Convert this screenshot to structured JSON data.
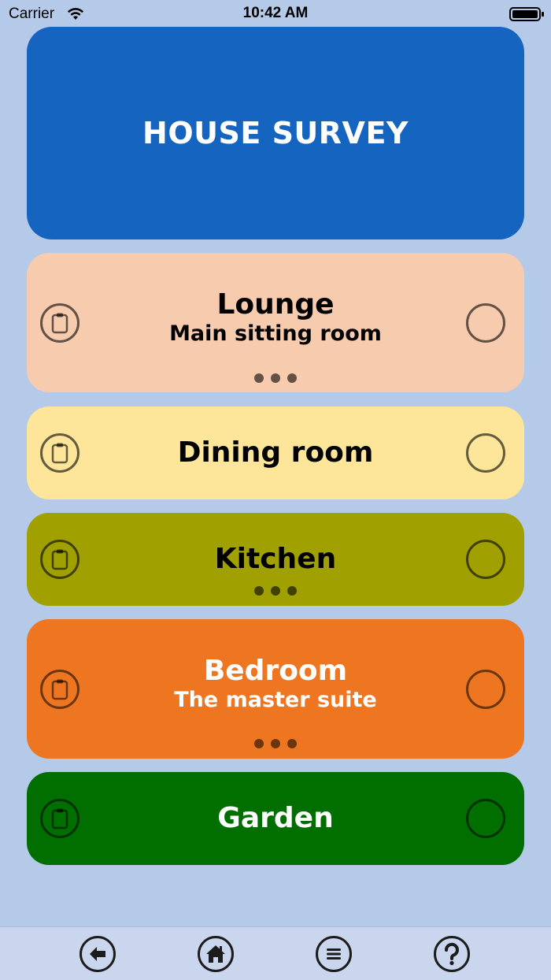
{
  "status_bar": {
    "carrier": "Carrier",
    "time": "10:42 AM"
  },
  "header": {
    "title": "HOUSE SURVEY",
    "color": "#1565c0"
  },
  "rooms": [
    {
      "name": "Lounge",
      "description": "Main sitting room",
      "has_more": true,
      "bg": "#f7cbae",
      "text_color": "#000000"
    },
    {
      "name": "Dining room",
      "description": "",
      "has_more": false,
      "bg": "#fde599",
      "text_color": "#000000"
    },
    {
      "name": "Kitchen",
      "description": "",
      "has_more": true,
      "bg": "#a0a000",
      "text_color": "#000000"
    },
    {
      "name": "Bedroom",
      "description": "The master suite",
      "has_more": true,
      "bg": "#ee7621",
      "text_color": "#ffffff"
    },
    {
      "name": "Garden",
      "description": "",
      "has_more": false,
      "bg": "#006f00",
      "text_color": "#ffffff"
    }
  ],
  "icons": {
    "room_left": "clipboard-icon",
    "room_right": "empty-circle-icon"
  },
  "tab_bar": {
    "items": [
      "back-arrow-icon",
      "home-icon",
      "menu-icon",
      "help-icon"
    ]
  }
}
